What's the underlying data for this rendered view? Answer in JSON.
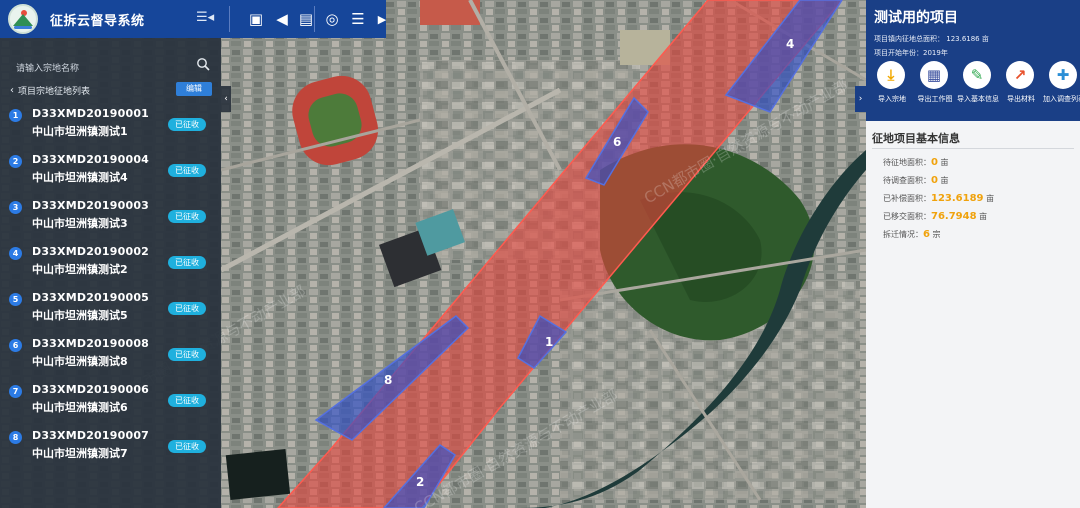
{
  "app": {
    "title": "征拆云督导系统"
  },
  "toolbar": {
    "icons": [
      "layers-icon",
      "back-icon",
      "document-icon",
      "user-icon",
      "list-icon",
      "chevron-right-icon"
    ]
  },
  "left_panel": {
    "search_placeholder": "请输入宗地名称",
    "list_title": "项目宗地征地列表",
    "edit_label": "编辑",
    "items": [
      {
        "index": "1",
        "code": "D33XMD20190001",
        "name": "中山市坦洲镇测试1",
        "status": "已征收"
      },
      {
        "index": "2",
        "code": "D33XMD20190004",
        "name": "中山市坦洲镇测试4",
        "status": "已征收"
      },
      {
        "index": "3",
        "code": "D33XMD20190003",
        "name": "中山市坦洲镇测试3",
        "status": "已征收"
      },
      {
        "index": "4",
        "code": "D33XMD20190002",
        "name": "中山市坦洲镇测试2",
        "status": "已征收"
      },
      {
        "index": "5",
        "code": "D33XMD20190005",
        "name": "中山市坦洲镇测试5",
        "status": "已征收"
      },
      {
        "index": "6",
        "code": "D33XMD20190008",
        "name": "中山市坦洲镇测试8",
        "status": "已征收"
      },
      {
        "index": "7",
        "code": "D33XMD20190006",
        "name": "中山市坦洲镇测试6",
        "status": "已征收"
      },
      {
        "index": "8",
        "code": "D33XMD20190007",
        "name": "中山市坦洲镇测试7",
        "status": "已征收"
      }
    ]
  },
  "right_panel": {
    "project_title": "测试用的项目",
    "total_area_label": "项目镇内征地总面积：",
    "total_area_value": "123.6186",
    "total_area_unit": "亩",
    "start_year_label": "项目开始年份：",
    "start_year_value": "2019年",
    "actions": [
      {
        "label": "导入宗地",
        "icon": "import-parcel-icon",
        "color": "#f2a900"
      },
      {
        "label": "导出工作图",
        "icon": "export-map-icon",
        "color": "#3a4f9e"
      },
      {
        "label": "导入基本信息",
        "icon": "import-info-icon",
        "color": "#2fa84f"
      },
      {
        "label": "导出材料",
        "icon": "export-material-icon",
        "color": "#e8512b"
      },
      {
        "label": "加入调查列表",
        "icon": "add-survey-icon",
        "color": "#2c8fd6"
      }
    ],
    "info_title": "征地项目基本信息",
    "stats": [
      {
        "label": "待征地面积：",
        "value": "0",
        "unit": "亩"
      },
      {
        "label": "待调查面积：",
        "value": "0",
        "unit": "亩"
      },
      {
        "label": "已补偿面积：",
        "value": "123.6189",
        "unit": "亩"
      },
      {
        "label": "已移交面积：",
        "value": "76.7948",
        "unit": "亩"
      },
      {
        "label": "拆迁情况：",
        "value": "6",
        "unit": "宗"
      }
    ]
  },
  "map": {
    "parcel_labels": [
      "1",
      "2",
      "4",
      "6",
      "8"
    ],
    "corridor_color": "#e8453c",
    "parcel_color": "#2f4fc8"
  },
  "watermark": "CCN都市圈·自然资源与不动产业部"
}
